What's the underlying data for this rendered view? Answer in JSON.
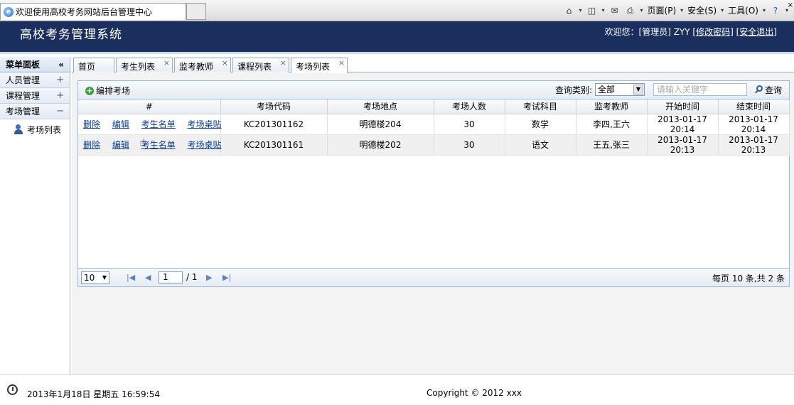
{
  "browser": {
    "tab_title": "欢迎使用高校考务网站后台管理中心",
    "menu": [
      "页面(P)",
      "安全(S)",
      "工具(O)"
    ],
    "icons": [
      "home-icon",
      "rss-icon",
      "mail-icon",
      "print-icon",
      "help-icon"
    ]
  },
  "app": {
    "title": "高校考务管理系统",
    "welcome": "欢迎您：[管理员] ZYY",
    "change_password": "[修改密码]",
    "logout": "[安全退出]"
  },
  "sidebar": {
    "header": "菜单面板",
    "collapse_glyph": "«",
    "groups": [
      {
        "label": "人员管理",
        "toggle": "+"
      },
      {
        "label": "课程管理",
        "toggle": "+"
      },
      {
        "label": "考场管理",
        "toggle": "−"
      }
    ],
    "sub_item": "考场列表"
  },
  "tabs": [
    {
      "label": "首页"
    },
    {
      "label": "考生列表"
    },
    {
      "label": "监考教师"
    },
    {
      "label": "课程列表"
    },
    {
      "label": "考场列表"
    }
  ],
  "toolbar": {
    "add_label": "编排考场",
    "query_type_label": "查询类别:",
    "query_type_value": "全部",
    "keyword_placeholder": "请输入关键字",
    "search_label": "查询"
  },
  "table": {
    "headers": [
      "#",
      "考场代码",
      "考场地点",
      "考场人数",
      "考试科目",
      "监考教师",
      "开始时间",
      "结束时间"
    ],
    "row_actions": [
      "删除",
      "编辑",
      "考生名单",
      "考场桌贴"
    ],
    "rows": [
      [
        "KC201301162",
        "明德楼204",
        "30",
        "数学",
        "李四,王六",
        "2013-01-17 20:14",
        "2013-01-17 20:14"
      ],
      [
        "KC201301161",
        "明德楼202",
        "30",
        "语文",
        "王五,张三",
        "2013-01-17 20:13",
        "2013-01-17 20:13"
      ]
    ]
  },
  "pager": {
    "page_size": "10",
    "current_page": "1",
    "total_pages": "/ 1",
    "info": "每页 10 条,共 2 条"
  },
  "footer": {
    "datetime": "2013年1月18日 星期五 16:59:54",
    "copyright": "Copyright © 2012 xxx"
  }
}
